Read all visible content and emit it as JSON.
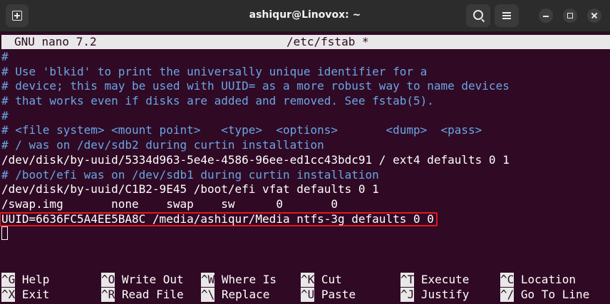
{
  "window": {
    "title": "ashiqur@Linovox: ~"
  },
  "nano": {
    "version": "GNU nano 7.2",
    "filename": "/etc/fstab *"
  },
  "lines": [
    {
      "text": "#",
      "kind": "comment"
    },
    {
      "text": "# Use 'blkid' to print the universally unique identifier for a",
      "kind": "comment"
    },
    {
      "text": "# device; this may be used with UUID= as a more robust way to name devices",
      "kind": "comment"
    },
    {
      "text": "# that works even if disks are added and removed. See fstab(5).",
      "kind": "comment"
    },
    {
      "text": "#",
      "kind": "comment"
    },
    {
      "text": "# <file system> <mount point>   <type>  <options>       <dump>  <pass>",
      "kind": "comment"
    },
    {
      "text": "# / was on /dev/sdb2 during curtin installation",
      "kind": "comment"
    },
    {
      "text": "/dev/disk/by-uuid/5334d963-5e4e-4586-96ee-ed1cc43bdc91 / ext4 defaults 0 1",
      "kind": "text"
    },
    {
      "text": "# /boot/efi was on /dev/sdb1 during curtin installation",
      "kind": "comment"
    },
    {
      "text": "/dev/disk/by-uuid/C1B2-9E45 /boot/efi vfat defaults 0 1",
      "kind": "text"
    },
    {
      "text": "/swap.img       none    swap    sw      0       0",
      "kind": "text"
    },
    {
      "text": "UUID=6636FC5A4EE5BA8C /media/ashiqur/Media ntfs-3g defaults 0 0",
      "kind": "highlight"
    }
  ],
  "shortcuts": [
    {
      "key": "^G",
      "label": "Help"
    },
    {
      "key": "^O",
      "label": "Write Out"
    },
    {
      "key": "^W",
      "label": "Where Is"
    },
    {
      "key": "^K",
      "label": "Cut"
    },
    {
      "key": "^T",
      "label": "Execute"
    },
    {
      "key": "^C",
      "label": "Location"
    },
    {
      "key": "^X",
      "label": "Exit"
    },
    {
      "key": "^R",
      "label": "Read File"
    },
    {
      "key": "^\\",
      "label": "Replace"
    },
    {
      "key": "^U",
      "label": "Paste"
    },
    {
      "key": "^J",
      "label": "Justify"
    },
    {
      "key": "^/",
      "label": "Go To Line"
    }
  ],
  "colors": {
    "background": "#300a24",
    "comment": "#6aa5e6",
    "highlight_border": "#e3171e",
    "bar": "#e8e8e8"
  }
}
